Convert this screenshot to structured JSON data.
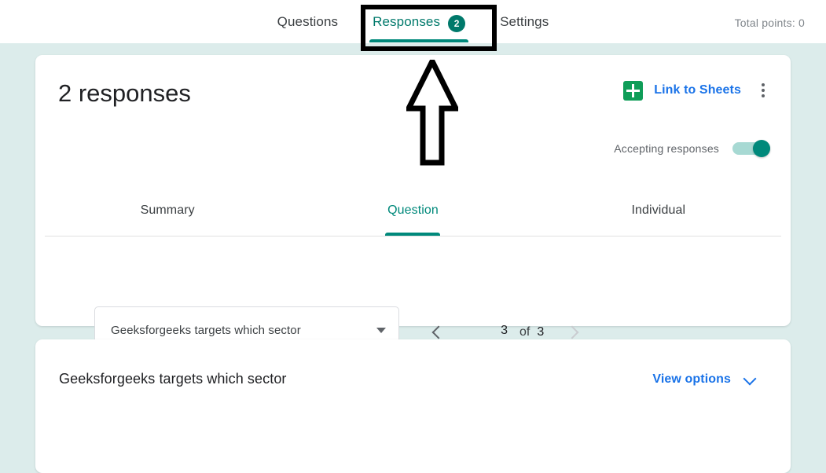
{
  "header": {
    "tabs": [
      {
        "label": "Questions",
        "active": false,
        "badge": null
      },
      {
        "label": "Responses",
        "active": true,
        "badge": "2"
      },
      {
        "label": "Settings",
        "active": false,
        "badge": null
      }
    ],
    "total_points": "Total points: 0"
  },
  "responses_card": {
    "count_text": "2 responses",
    "sheets_link_label": "Link to Sheets",
    "sheets_icon": "google-sheets-icon",
    "more_icon": "more-vert-icon",
    "accepting_label": "Accepting responses",
    "accepting_toggle_state": "on",
    "subtabs": [
      {
        "label": "Summary",
        "active": false
      },
      {
        "label": "Question",
        "active": true
      },
      {
        "label": "Individual",
        "active": false
      }
    ],
    "question_select": {
      "value": "Geeksforgeeks targets which sector",
      "caret_icon": "caret-down-icon"
    },
    "pager": {
      "prev_icon": "chevron-left-icon",
      "next_icon": "chevron-right-icon",
      "current": "3",
      "of_label": "of",
      "total": "3"
    }
  },
  "question_card": {
    "title": "Geeksforgeeks targets which sector",
    "view_options_label": "View options",
    "view_options_icon": "chevron-down-icon"
  },
  "annotations": {
    "highlight_rect_target": "Responses tab",
    "arrow_direction": "up",
    "color": "#000000"
  },
  "colors": {
    "page_background": "#dceceb",
    "accent_teal": "#00897b",
    "badge_teal": "#00796b",
    "link_blue": "#1a73e8",
    "sheets_green": "#0f9d58",
    "card_white": "#ffffff",
    "text_primary": "#202124",
    "text_secondary": "#5f6368"
  }
}
